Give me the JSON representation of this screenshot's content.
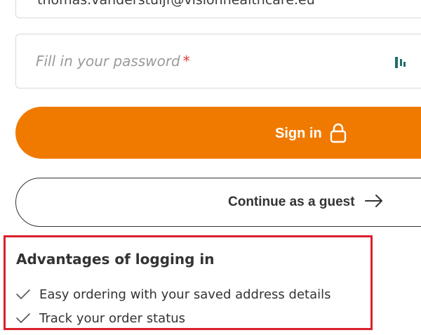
{
  "login": {
    "email_value": "thomas.vanderstuijf@visionhealthcare.eu",
    "password_placeholder": "Fill in your password",
    "password_required_marker": "*",
    "show_password_icon": "password-visibility-icon",
    "sign_in_label": "Sign in",
    "sign_in_icon": "lock-icon",
    "guest_label": "Continue as a guest",
    "guest_icon": "arrow-right-icon"
  },
  "advantages": {
    "title": "Advantages of logging in",
    "items": [
      "Easy ordering with your saved address details",
      "Track your order status"
    ]
  },
  "colors": {
    "accent": "#f07a00",
    "highlight_border": "#d9202d",
    "icon_teal": "#1f6f6b",
    "required": "#e53935"
  }
}
